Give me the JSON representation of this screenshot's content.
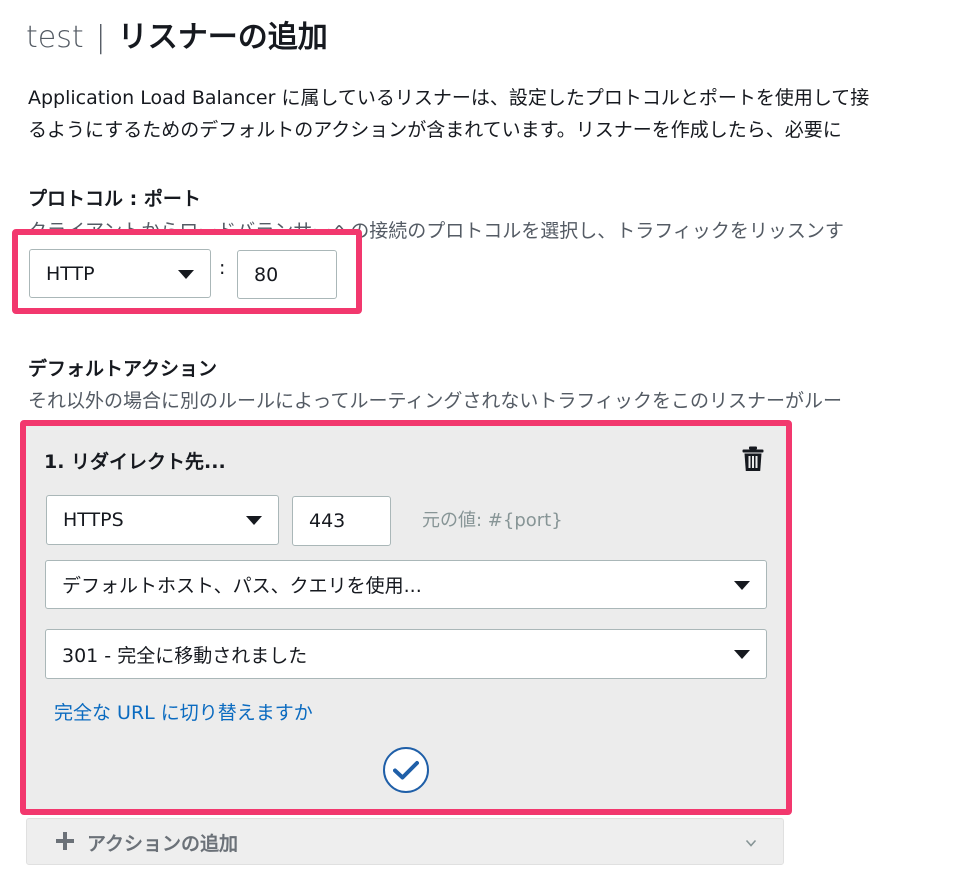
{
  "header": {
    "prefix": "test",
    "separator": "|",
    "title": "リスナーの追加"
  },
  "intro": {
    "line1": "Application Load Balancer に属しているリスナーは、設定したプロトコルとポートを使用して接",
    "line2": "るようにするためのデフォルトのアクションが含まれています。リスナーを作成したら、必要に"
  },
  "protocol_port": {
    "label": "プロトコル : ポート",
    "description": "クライアントからロードバランサーへの接続のプロトコルを選択し、トラフィックをリッスンす",
    "protocol_value": "HTTP",
    "separator": ":",
    "port_value": "80"
  },
  "default_action": {
    "label": "デフォルトアクション",
    "description": "それ以外の場合に別のルールによってルーティングされないトラフィックをこのリスナーがルー",
    "action": {
      "title": "1. リダイレクト先...",
      "protocol_value": "HTTPS",
      "port_value": "443",
      "original_value_hint": "元の値: #{port}",
      "host_option": "デフォルトホスト、パス、クエリを使用...",
      "status_option": "301 - 完全に移動されました",
      "switch_link": "完全な URL に切り替えますか"
    },
    "add_action_label": "アクションの追加"
  },
  "colors": {
    "highlight": "#f2386e",
    "link": "#0b6bc0",
    "panel_bg": "#ececec"
  },
  "icons": [
    "trash-icon",
    "check-circle-icon",
    "plus-icon",
    "chevron-down-icon",
    "caret-down-icon"
  ]
}
